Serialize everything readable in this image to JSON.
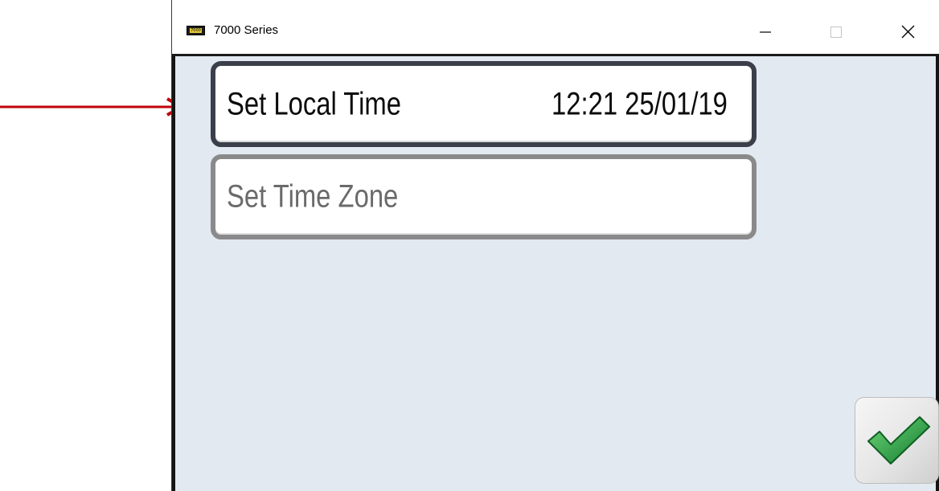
{
  "window": {
    "title": "7000 Series",
    "icon": "device-icon",
    "icon_text": "7000",
    "controls": [
      "minimize-icon",
      "maximize-icon",
      "close-icon"
    ]
  },
  "menu": {
    "items": [
      {
        "label": "Set Local Time",
        "value": "12:21 25/01/19",
        "selected": true
      },
      {
        "label": "Set Time Zone",
        "value": "",
        "selected": false
      }
    ]
  },
  "actions": {
    "confirm_icon": "checkmark-icon"
  },
  "colors": {
    "client_background": "#e3e9f1",
    "selected_border": "#3c3f4b",
    "unselected_border": "#8a8a8a",
    "pointer_arrow": "#c0000a",
    "checkmark_green": "#1e9a3a"
  }
}
